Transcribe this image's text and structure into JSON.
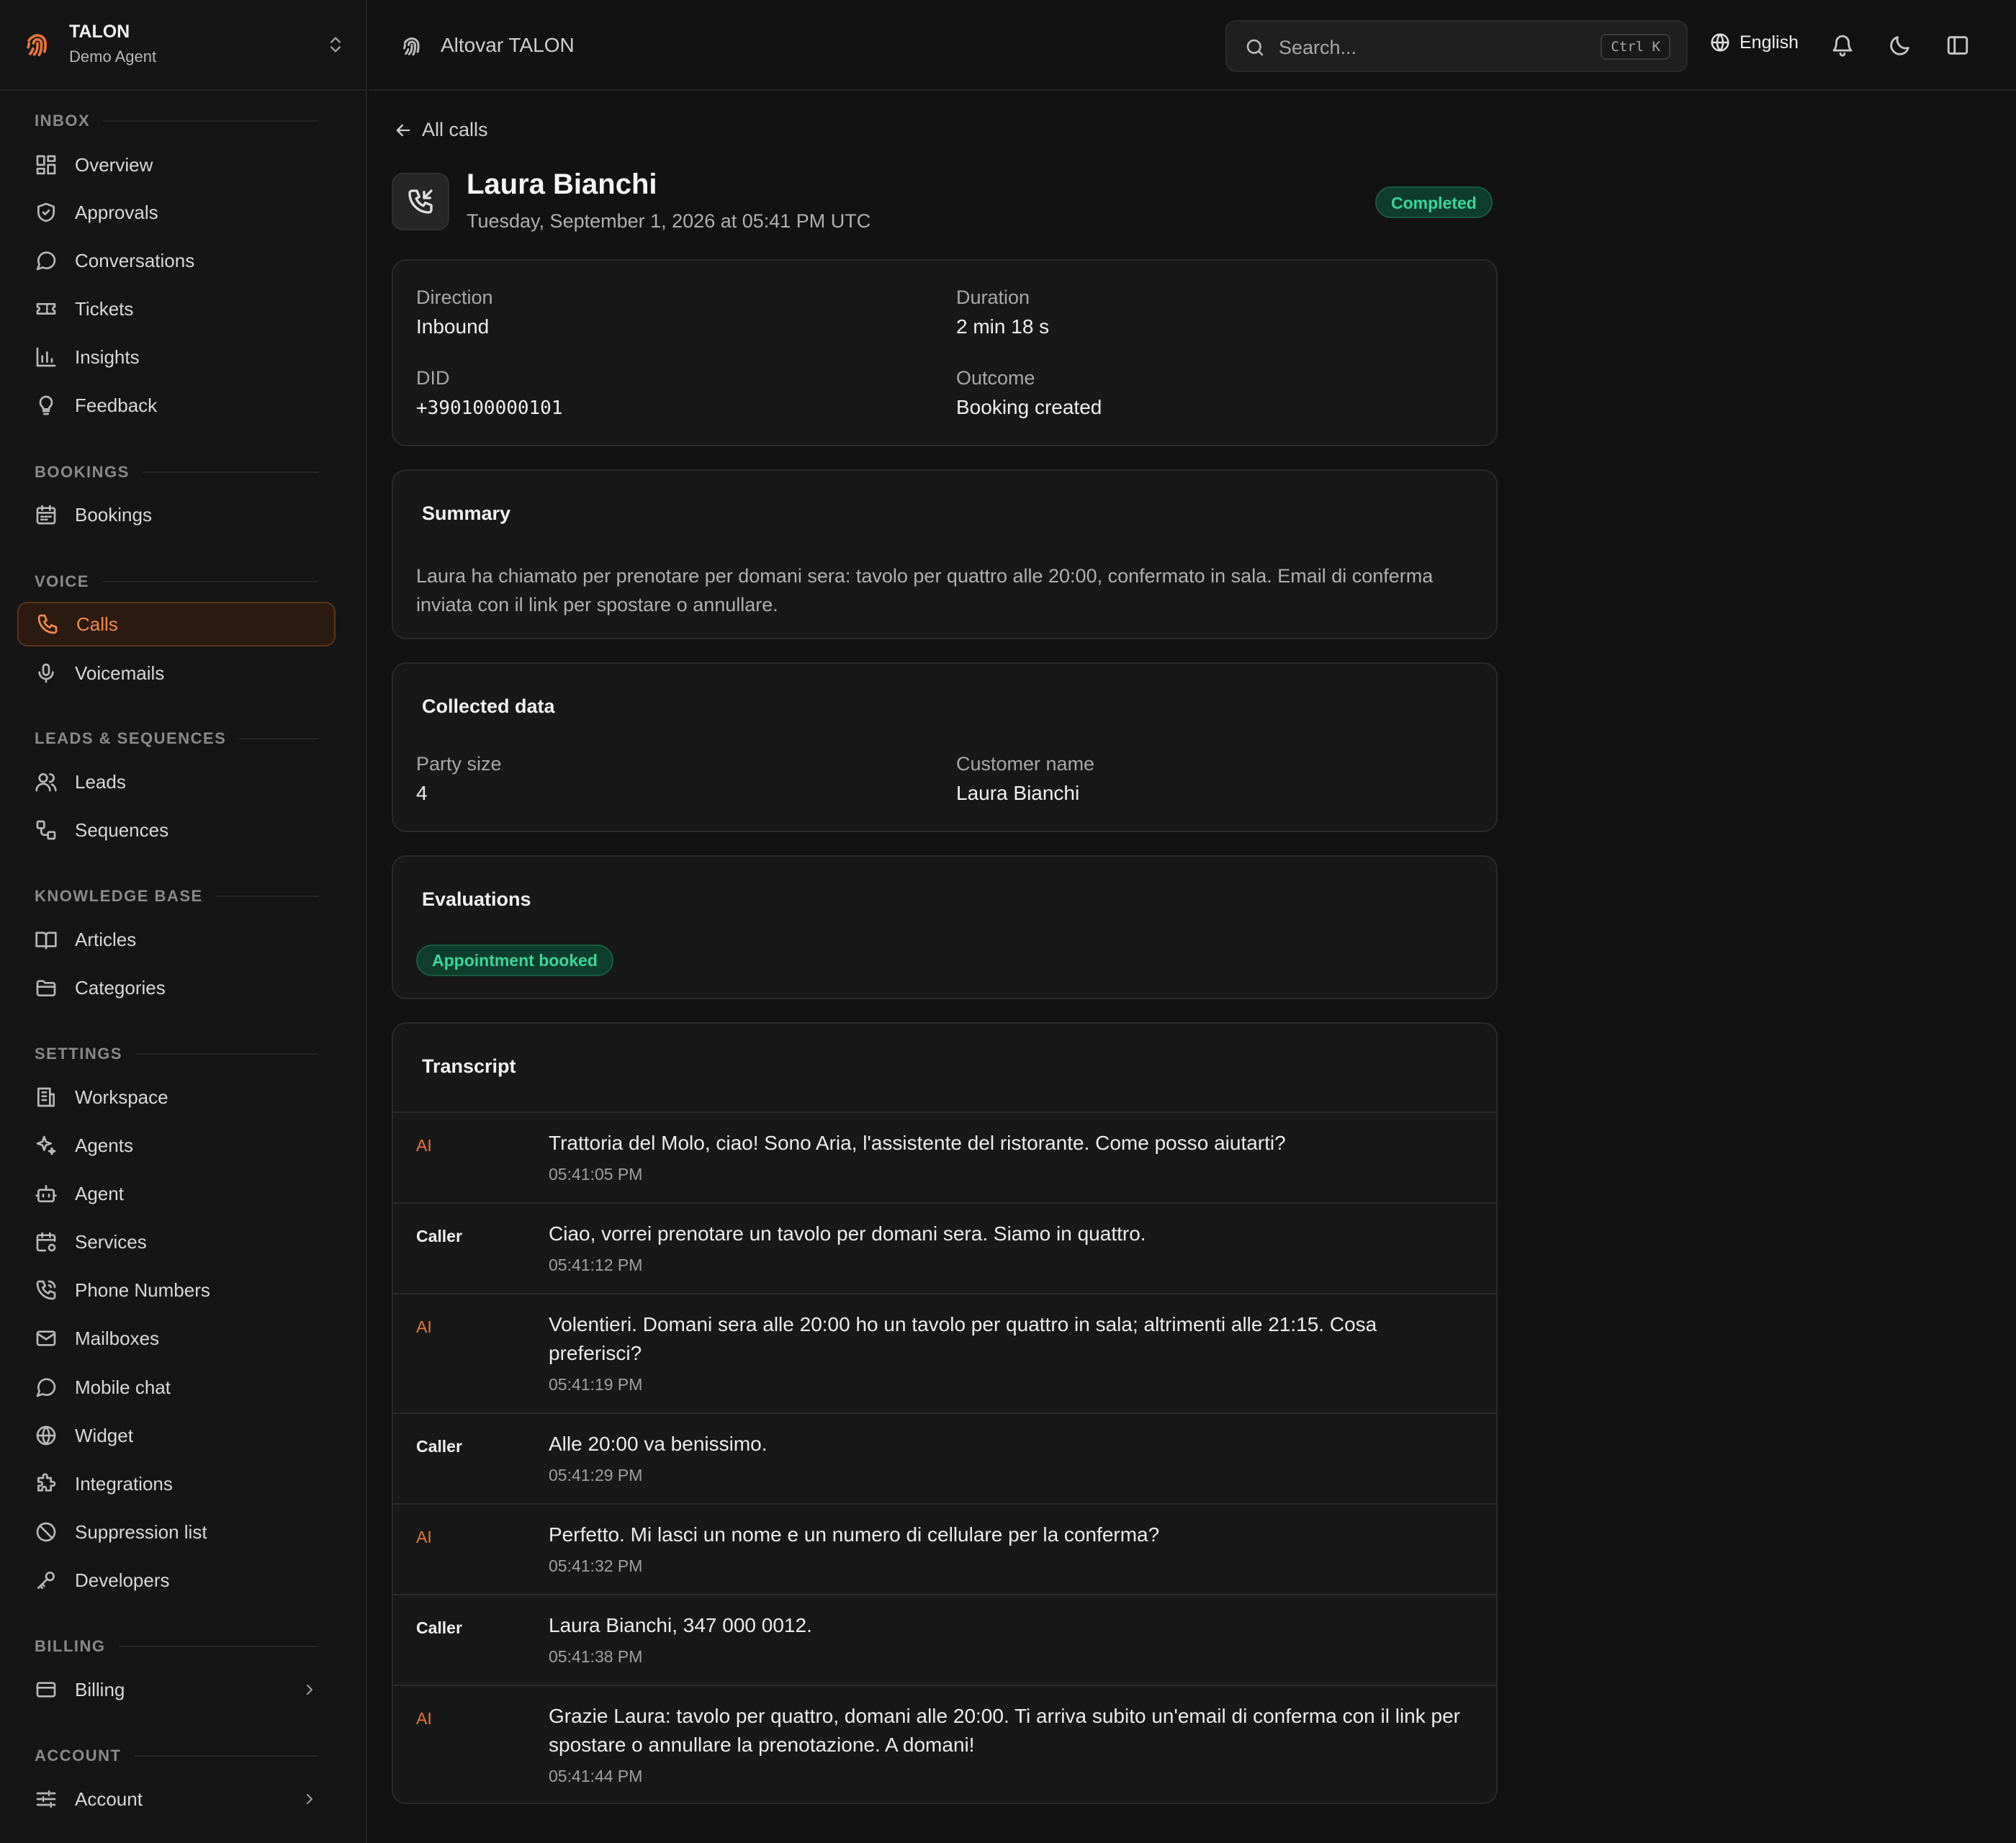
{
  "brand": {
    "name": "TALON",
    "subtitle": "Demo Agent"
  },
  "sidebar": {
    "sections": [
      {
        "label": "INBOX"
      },
      {
        "label": "BOOKINGS"
      },
      {
        "label": "VOICE"
      },
      {
        "label": "LEADS & SEQUENCES"
      },
      {
        "label": "KNOWLEDGE BASE"
      },
      {
        "label": "SETTINGS"
      },
      {
        "label": "BILLING"
      },
      {
        "label": "ACCOUNT"
      }
    ],
    "items": [
      {
        "label": "Overview",
        "icon": "dashboard-icon"
      },
      {
        "label": "Approvals",
        "icon": "shield-check-icon"
      },
      {
        "label": "Conversations",
        "icon": "chat-bubble-icon"
      },
      {
        "label": "Tickets",
        "icon": "ticket-icon"
      },
      {
        "label": "Insights",
        "icon": "bar-chart-icon"
      },
      {
        "label": "Feedback",
        "icon": "lightbulb-icon"
      },
      {
        "label": "Bookings",
        "icon": "calendar-icon"
      },
      {
        "label": "Calls",
        "icon": "phone-icon",
        "active": true
      },
      {
        "label": "Voicemails",
        "icon": "microphone-icon"
      },
      {
        "label": "Leads",
        "icon": "users-icon"
      },
      {
        "label": "Sequences",
        "icon": "workflow-icon"
      },
      {
        "label": "Articles",
        "icon": "book-open-icon"
      },
      {
        "label": "Categories",
        "icon": "folder-icon"
      },
      {
        "label": "Workspace",
        "icon": "building-icon"
      },
      {
        "label": "Agents",
        "icon": "sparkles-icon"
      },
      {
        "label": "Agent",
        "icon": "bot-icon"
      },
      {
        "label": "Services",
        "icon": "calendar-cog-icon"
      },
      {
        "label": "Phone Numbers",
        "icon": "phone-call-icon"
      },
      {
        "label": "Mailboxes",
        "icon": "mail-icon"
      },
      {
        "label": "Mobile chat",
        "icon": "chat-bubble-icon"
      },
      {
        "label": "Widget",
        "icon": "globe-icon"
      },
      {
        "label": "Integrations",
        "icon": "puzzle-icon"
      },
      {
        "label": "Suppression list",
        "icon": "ban-icon"
      },
      {
        "label": "Developers",
        "icon": "key-icon"
      },
      {
        "label": "Billing",
        "icon": "credit-card-icon"
      },
      {
        "label": "Account",
        "icon": "sliders-icon"
      }
    ]
  },
  "header": {
    "title": "Altovar TALON",
    "search_placeholder": "Search...",
    "search_shortcut": "Ctrl K",
    "language": "English"
  },
  "call": {
    "back_label": "All calls",
    "name": "Laura Bianchi",
    "datetime": "Tuesday, September 1, 2026 at 05:41 PM UTC",
    "status": "Completed",
    "details": {
      "direction_label": "Direction",
      "direction": "Inbound",
      "duration_label": "Duration",
      "duration": "2 min 18 s",
      "did_label": "DID",
      "did": "+390100000101",
      "outcome_label": "Outcome",
      "outcome": "Booking created"
    },
    "summary_title": "Summary",
    "summary": "Laura ha chiamato per prenotare per domani sera: tavolo per quattro alle 20:00, confermato in sala. Email di conferma inviata con il link per spostare o annullare.",
    "collected": {
      "title": "Collected data",
      "party_size_label": "Party size",
      "party_size": "4",
      "customer_name_label": "Customer name",
      "customer_name": "Laura Bianchi"
    },
    "evaluations": {
      "title": "Evaluations",
      "badge": "Appointment booked"
    },
    "transcript": {
      "title": "Transcript",
      "lines": [
        {
          "speaker": "AI",
          "text": "Trattoria del Molo, ciao! Sono Aria, l'assistente del ristorante. Come posso aiutarti?",
          "time": "05:41:05 PM"
        },
        {
          "speaker": "Caller",
          "text": "Ciao, vorrei prenotare un tavolo per domani sera. Siamo in quattro.",
          "time": "05:41:12 PM"
        },
        {
          "speaker": "AI",
          "text": "Volentieri. Domani sera alle 20:00 ho un tavolo per quattro in sala; altrimenti alle 21:15. Cosa preferisci?",
          "time": "05:41:19 PM"
        },
        {
          "speaker": "Caller",
          "text": "Alle 20:00 va benissimo.",
          "time": "05:41:29 PM"
        },
        {
          "speaker": "AI",
          "text": "Perfetto. Mi lasci un nome e un numero di cellulare per la conferma?",
          "time": "05:41:32 PM"
        },
        {
          "speaker": "Caller",
          "text": "Laura Bianchi, 347 000 0012.",
          "time": "05:41:38 PM"
        },
        {
          "speaker": "AI",
          "text": "Grazie Laura: tavolo per quattro, domani alle 20:00. Ti arriva subito un'email di conferma con il link per spostare o annullare la prenotazione. A domani!",
          "time": "05:41:44 PM"
        }
      ]
    }
  },
  "colors": {
    "accent": "#e8743b",
    "success": "#3ad69a",
    "background": "#121212"
  }
}
